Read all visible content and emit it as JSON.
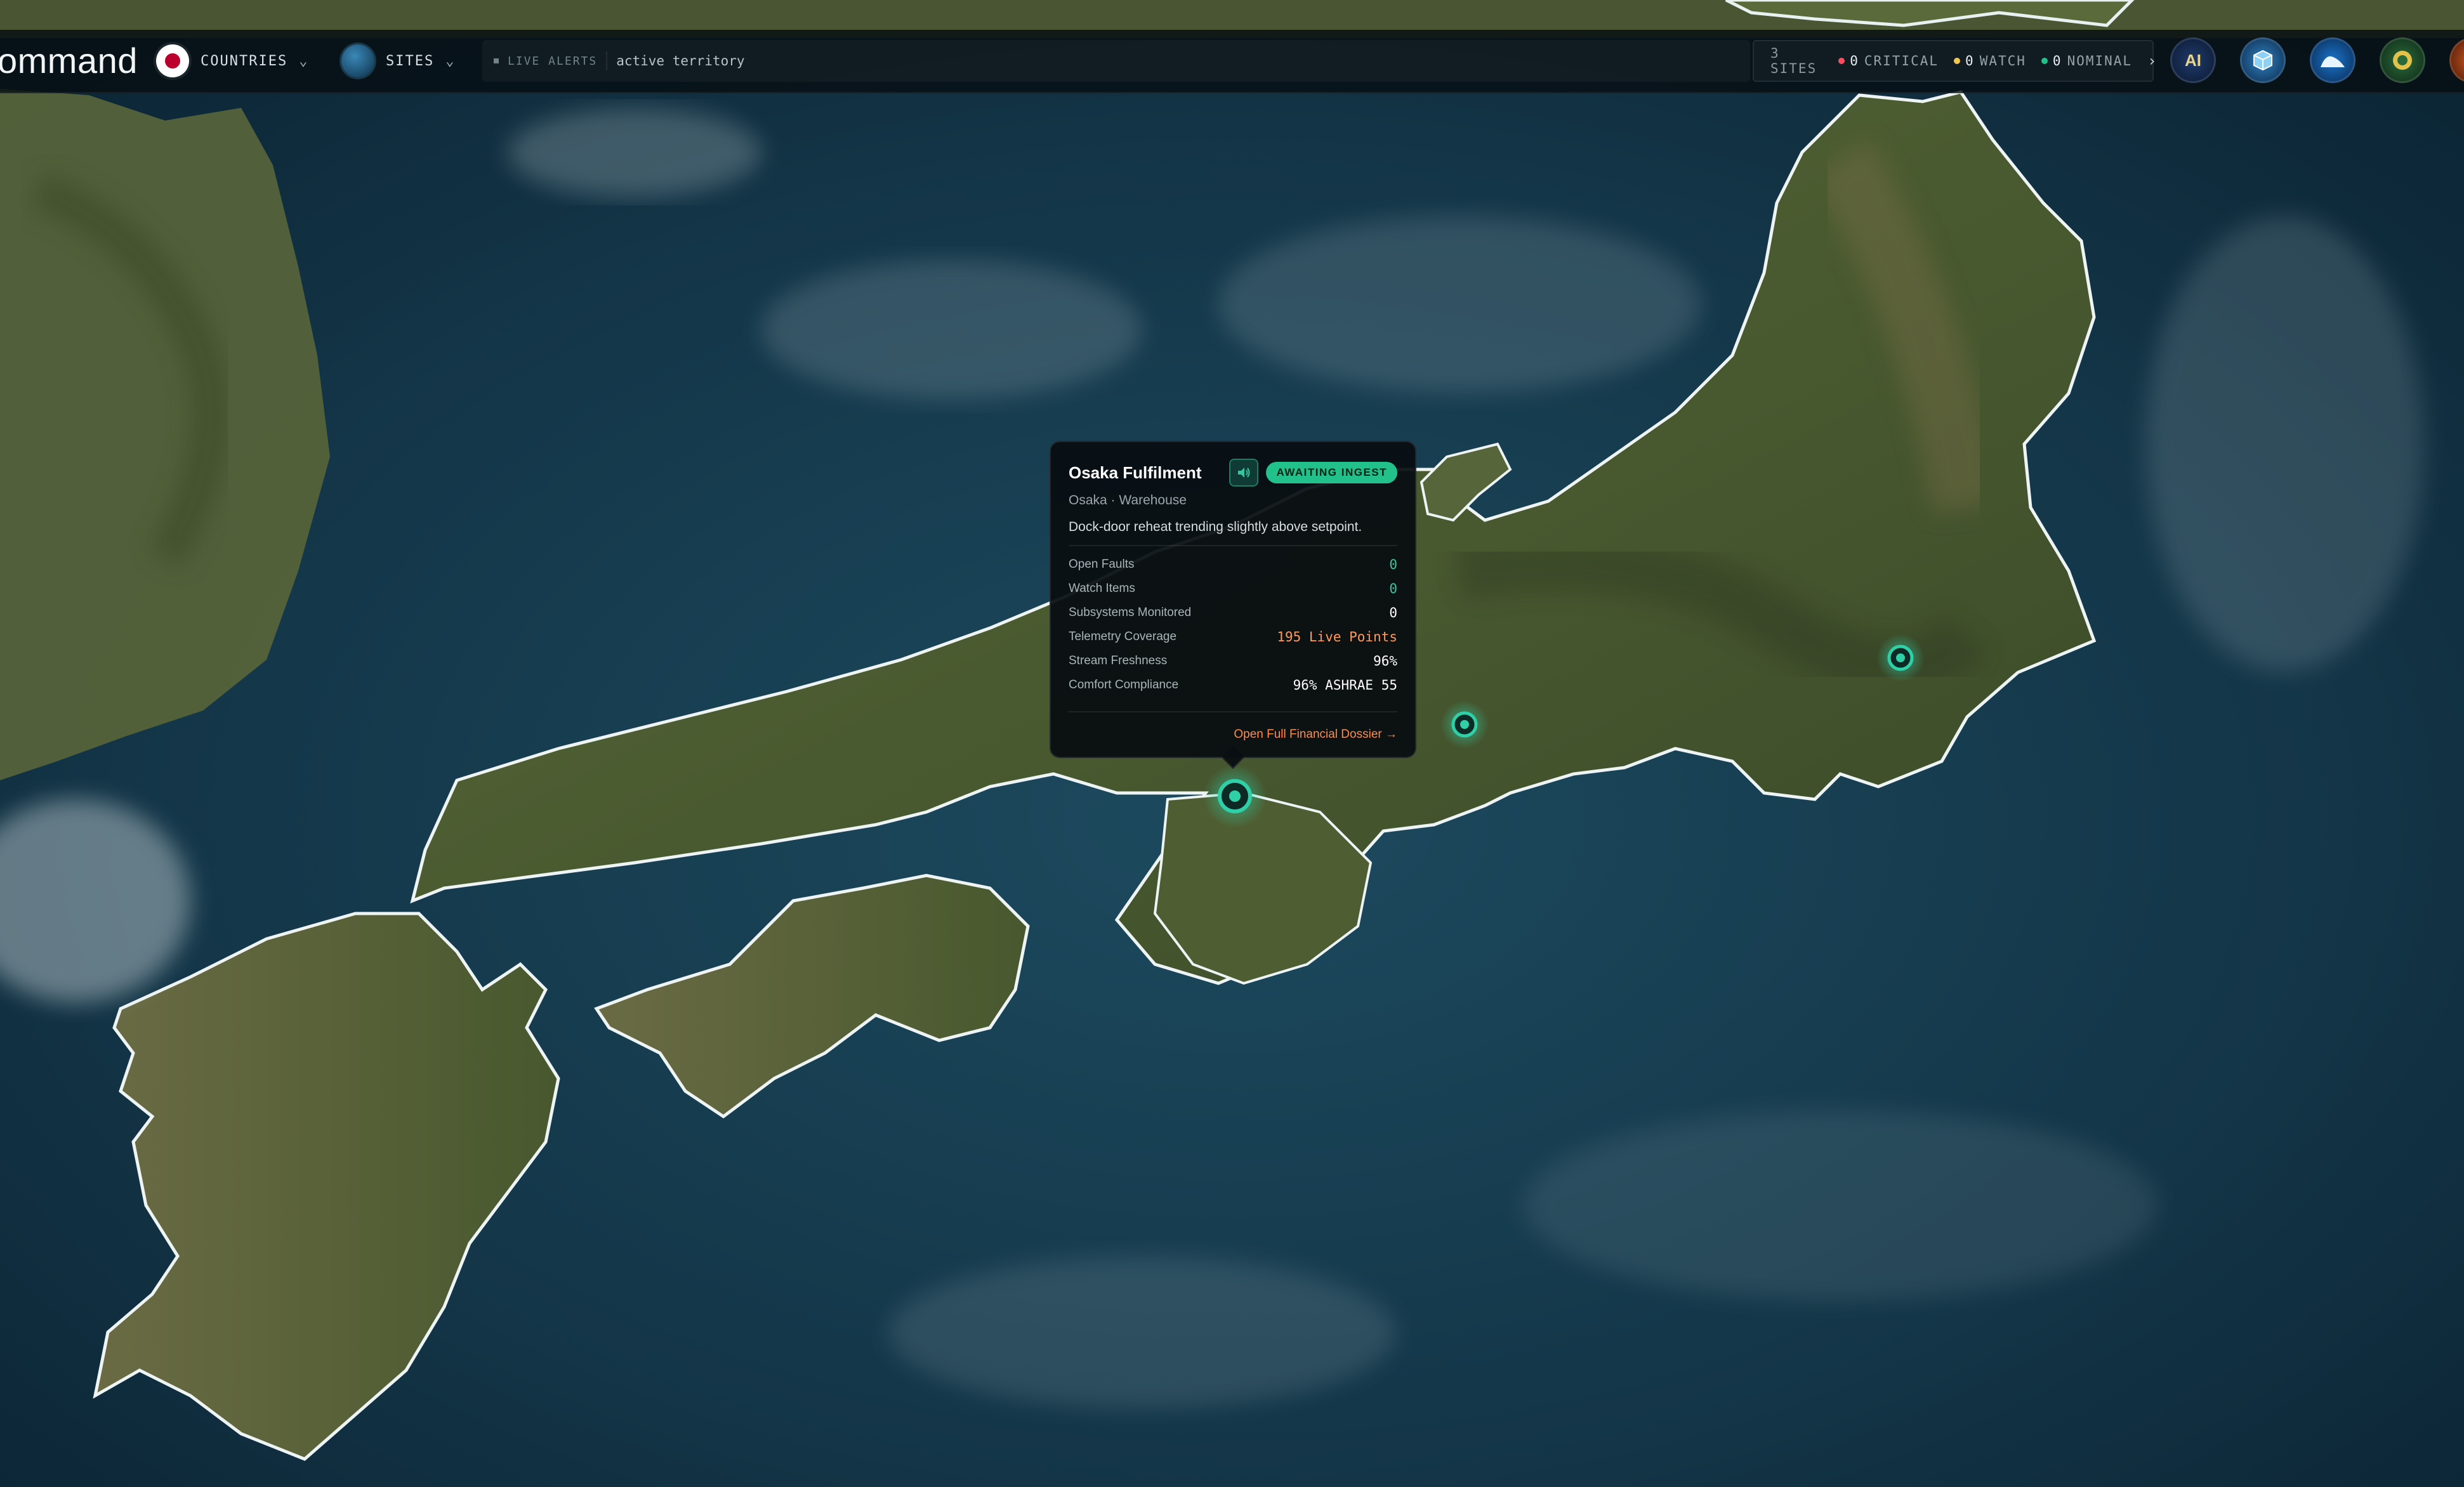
{
  "header": {
    "brand": "ommand",
    "countries_label": "COUNTRIES",
    "sites_label": "SITES",
    "live_alerts_label": "LIVE ALERTS",
    "live_alerts_value": "active territory"
  },
  "status": {
    "sites": "3 SITES",
    "critical_count": "0",
    "critical_label": "CRITICAL",
    "watch_count": "0",
    "watch_label": "WATCH",
    "nominal_count": "0",
    "nominal_label": "NOMINAL",
    "critical_color": "#ff4d5e",
    "watch_color": "#f2c84b",
    "nominal_color": "#22c08a"
  },
  "dock": {
    "ai_label": "AI",
    "icons": [
      "ai-app-icon",
      "cube-app-icon",
      "wave-app-icon",
      "crest-app-icon",
      "flame-app-icon"
    ]
  },
  "tooltip": {
    "title": "Osaka Fulfilment",
    "badge": "AWAITING INGEST",
    "subtitle": "Osaka · Warehouse",
    "description": "Dock-door reheat trending slightly above setpoint.",
    "metrics": [
      {
        "label": "Open Faults",
        "value": "0"
      },
      {
        "label": "Watch Items",
        "value": "0"
      },
      {
        "label": "Subsystems Monitored",
        "value": "0"
      },
      {
        "label": "Telemetry Coverage",
        "value": "195 Live Points"
      },
      {
        "label": "Stream Freshness",
        "value": "96%"
      },
      {
        "label": "Comfort Compliance",
        "value": "96% ASHRAE 55"
      }
    ],
    "link": "Open Full Financial Dossier →"
  },
  "map": {
    "sites": [
      "osaka-site-marker",
      "nagoya-site-marker",
      "tokyo-site-marker"
    ],
    "accent": "#2fd0a8"
  }
}
